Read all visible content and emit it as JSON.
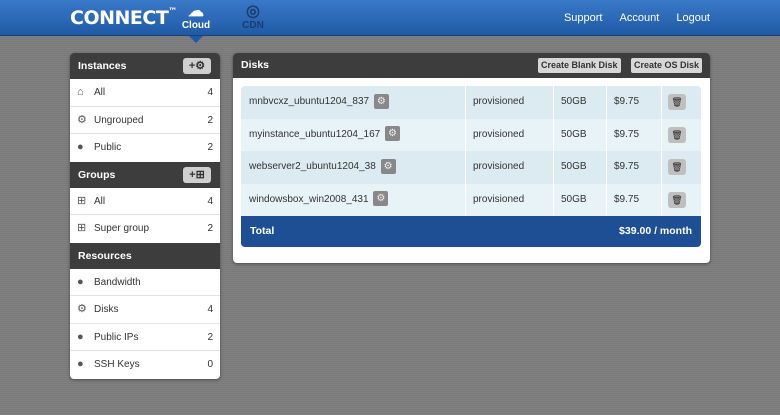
{
  "header": {
    "logo": "CONNECT",
    "logo_mark": "™",
    "tabs": [
      {
        "label": "Cloud",
        "icon": "cloud-icon",
        "active": true
      },
      {
        "label": "CDN",
        "icon": "cdn-icon",
        "active": false
      }
    ],
    "links": [
      "Support",
      "Account",
      "Logout"
    ]
  },
  "sidebar": {
    "instances": {
      "title": "Instances",
      "add_label": "+",
      "items": [
        {
          "label": "All",
          "count": "4",
          "icon": "home-icon"
        },
        {
          "label": "Ungrouped",
          "count": "2",
          "icon": "gears-icon"
        },
        {
          "label": "Public",
          "count": "2",
          "icon": "globe-icon"
        }
      ]
    },
    "groups": {
      "title": "Groups",
      "add_label": "+",
      "items": [
        {
          "label": "All",
          "count": "4",
          "icon": "hierarchy-icon"
        },
        {
          "label": "Super group",
          "count": "2",
          "icon": "hierarchy-icon"
        }
      ]
    },
    "resources": {
      "title": "Resources",
      "items": [
        {
          "label": "Bandwidth",
          "count": "",
          "icon": "globe-icon"
        },
        {
          "label": "Disks",
          "count": "4",
          "icon": "gears-icon"
        },
        {
          "label": "Public IPs",
          "count": "2",
          "icon": "globe-icon"
        },
        {
          "label": "SSH Keys",
          "count": "0",
          "icon": "globe-icon"
        }
      ]
    }
  },
  "disks": {
    "title": "Disks",
    "create_blank_label": "Create Blank Disk",
    "create_os_label": "Create OS Disk",
    "rows": [
      {
        "name": "mnbvcxz_ubuntu1204_837",
        "status": "provisioned",
        "size": "50GB",
        "price": "$9.75"
      },
      {
        "name": "myinstance_ubuntu1204_167",
        "status": "provisioned",
        "size": "50GB",
        "price": "$9.75"
      },
      {
        "name": "webserver2_ubuntu1204_38",
        "status": "provisioned",
        "size": "50GB",
        "price": "$9.75"
      },
      {
        "name": "windowsbox_win2008_431",
        "status": "provisioned",
        "size": "50GB",
        "price": "$9.75"
      }
    ],
    "total_label": "Total",
    "total_value": "$39.00 / month"
  },
  "colors": {
    "topbar": "#2a66b5",
    "total_bar": "#1e4e94",
    "panel_head": "#3d3d3d"
  }
}
